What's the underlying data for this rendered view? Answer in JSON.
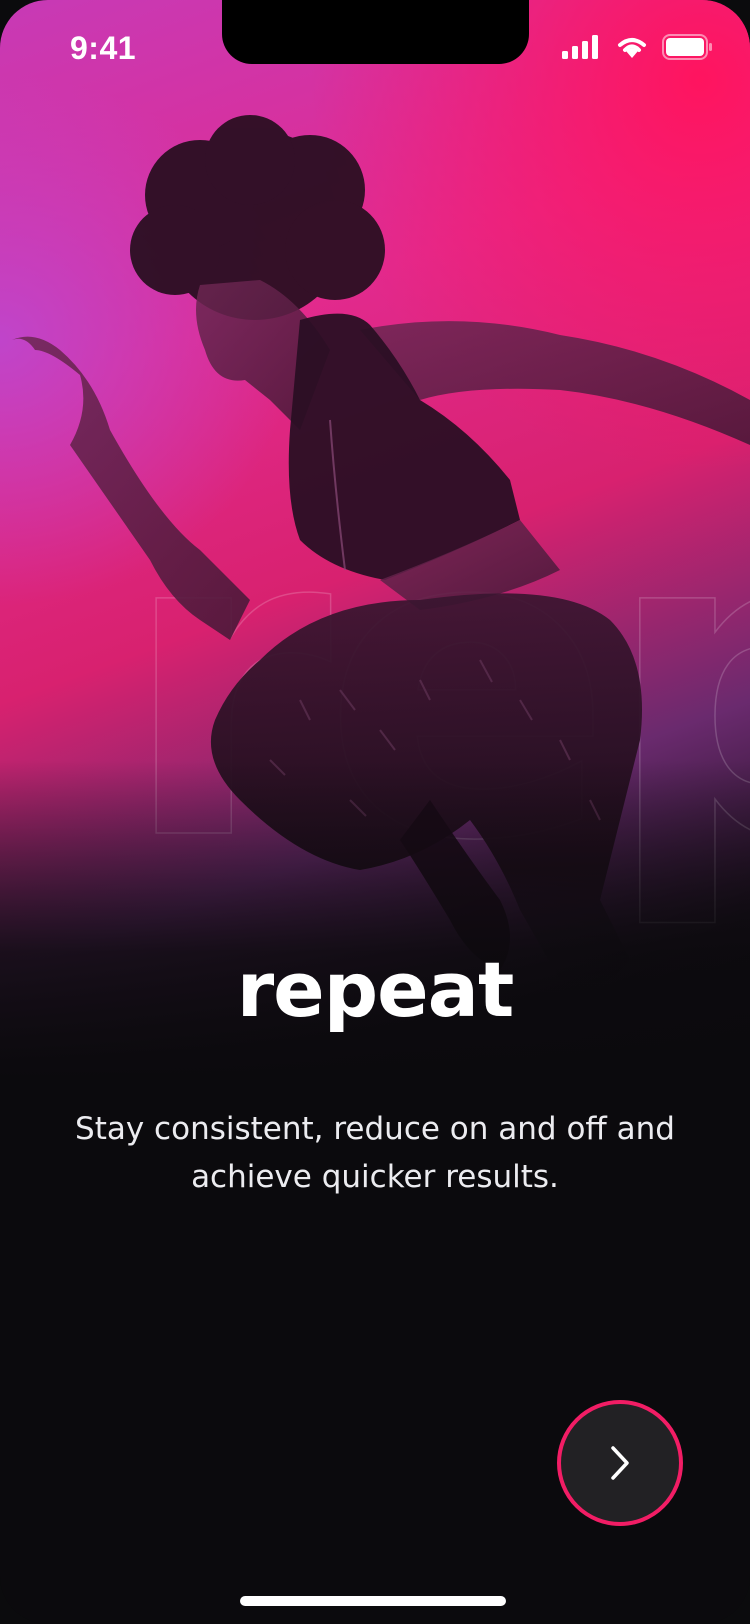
{
  "status_bar": {
    "time": "9:41"
  },
  "onboarding": {
    "background_word": "repeat",
    "title": "repeat",
    "description": "Stay consistent, reduce on and off and achieve quicker results."
  },
  "colors": {
    "accent": "#f21d65",
    "background": "#0b0a0d",
    "gradient_pink": "#ff1460",
    "gradient_purple": "#c040c0"
  },
  "icons": {
    "next": "chevron-right-icon"
  }
}
